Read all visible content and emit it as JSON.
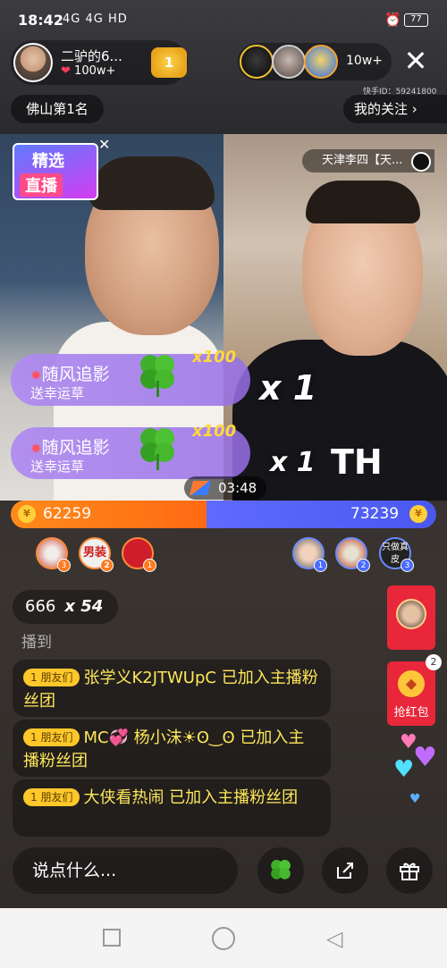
{
  "status_bar": {
    "time": "18:42",
    "network": "4G 4G HD",
    "battery": "77"
  },
  "host": {
    "name": "二驴的6...",
    "likes": "100w+",
    "badge_level": "1"
  },
  "viewers": {
    "count": "10w+"
  },
  "kuaishou_id": "快手ID：59241800",
  "rank_label": "佛山第1名",
  "follow_label": "我的关注 ›",
  "featured_live": {
    "line1": "精选",
    "line2": "直播"
  },
  "opponent": {
    "name": "天津李四【天..."
  },
  "gift_banners": [
    {
      "title": "随风追影",
      "subtitle": "送幸运草",
      "multiplier": "x100",
      "combo": "x 1"
    },
    {
      "title": "随风追影",
      "subtitle": "送幸运草",
      "multiplier": "x100",
      "combo": "x 1"
    }
  ],
  "pk": {
    "timer": "03:48",
    "left_score": "62259",
    "right_score": "73239",
    "left_share": 0.4595
  },
  "supporters_left": [
    {
      "rank": "3",
      "label": ""
    },
    {
      "rank": "2",
      "label": "男装"
    },
    {
      "rank": "1",
      "label": ""
    }
  ],
  "supporters_right": [
    {
      "rank": "1",
      "label": ""
    },
    {
      "rank": "2",
      "label": ""
    },
    {
      "rank": "3",
      "label": "只做真皮"
    }
  ],
  "gift_combo": {
    "count": "666",
    "multiplier": "x 54"
  },
  "faded_comment": "播到",
  "comments": [
    {
      "tag": "1 朋友们",
      "text": "张学义K2JTWUpC 已加入主播粉丝团"
    },
    {
      "tag": "1 朋友们",
      "text": "MC💞 杨小沫☀ʘ‿ʘ 已加入主播粉丝团"
    },
    {
      "tag": "1 朋友们",
      "text": "大侠看热闹 已加入主播粉丝团"
    }
  ],
  "red_packet": {
    "label": "抢红包",
    "count": "2"
  },
  "chat_input_placeholder": "说点什么..."
}
